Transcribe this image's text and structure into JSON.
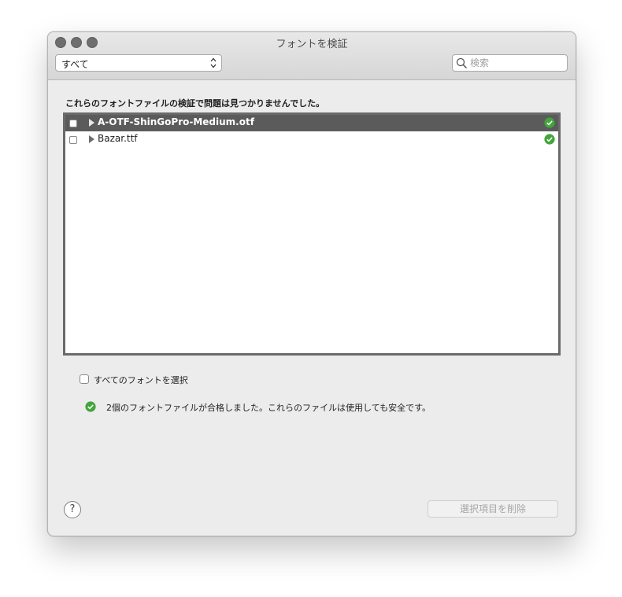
{
  "window": {
    "title": "フォントを検証"
  },
  "toolbar": {
    "filter_selected": "すべて",
    "search_placeholder": "検索"
  },
  "main": {
    "message": "これらのフォントファイルの検証で問題は見つかりませんでした。",
    "files": [
      {
        "name": "A-OTF-ShinGoPro-Medium.otf",
        "status_icon": "check-circle-icon",
        "selected": true
      },
      {
        "name": "Bazar.ttf",
        "status_icon": "check-circle-icon",
        "selected": false
      }
    ],
    "select_all_label": "すべてのフォントを選択",
    "summary": "2個のフォントファイルが合格しました。これらのファイルは使用しても安全です。"
  },
  "footer": {
    "help_label": "?",
    "delete_label": "選択項目を削除"
  },
  "colors": {
    "window_bg": "#ececec",
    "selected_row": "#5b5b5b",
    "success_green": "#43a53a",
    "disabled_text": "#a6a6a6"
  }
}
